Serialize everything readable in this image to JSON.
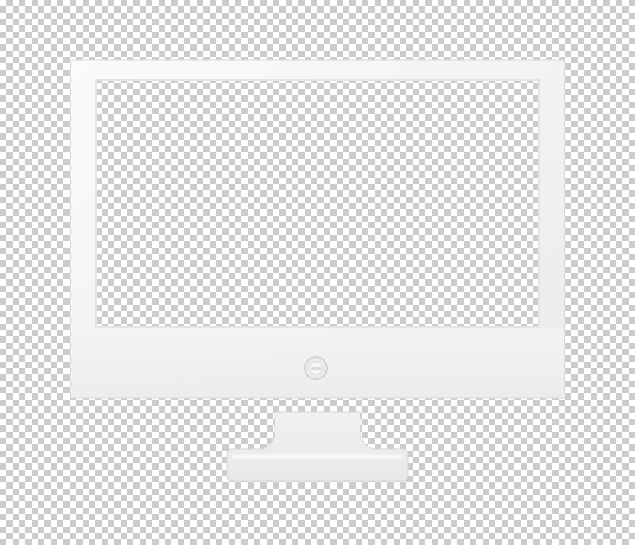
{
  "background": {
    "pattern": "transparency-checkerboard",
    "colors": [
      "#ffffff",
      "#cccccc"
    ]
  },
  "icon": {
    "name": "computer-monitor-icon",
    "fill_color": "#ffffff",
    "shade_color": "#e9e9ec",
    "edge_color": "#d6d6da"
  }
}
